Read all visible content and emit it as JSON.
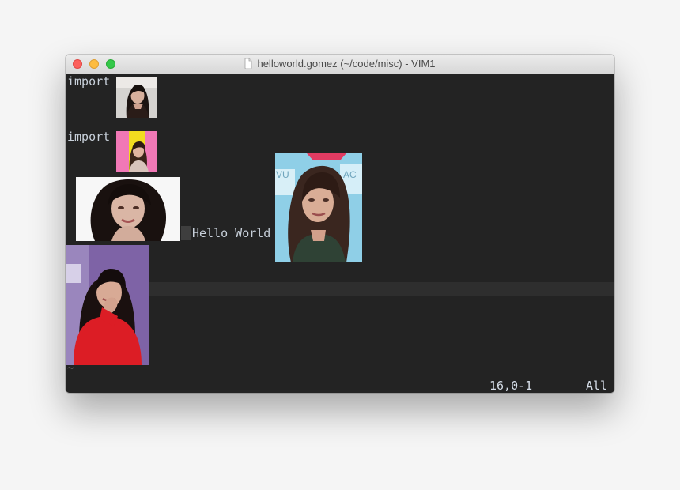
{
  "window": {
    "title": "helloworld.gomez (~/code/misc) - VIM1",
    "file_icon": "document-icon",
    "controls": [
      "close",
      "minimize",
      "zoom"
    ]
  },
  "editor": {
    "line1": "import",
    "line2": "import",
    "line3": "Hello World",
    "tilde": "~",
    "status_position": "16,0-1",
    "status_scroll": "All",
    "images": [
      {
        "name": "portrait-small-1",
        "icon": "photo-icon"
      },
      {
        "name": "portrait-small-2",
        "icon": "photo-icon"
      },
      {
        "name": "portrait-wide",
        "icon": "photo-icon"
      },
      {
        "name": "portrait-blue",
        "icon": "photo-icon"
      },
      {
        "name": "portrait-red",
        "icon": "photo-icon"
      }
    ]
  }
}
